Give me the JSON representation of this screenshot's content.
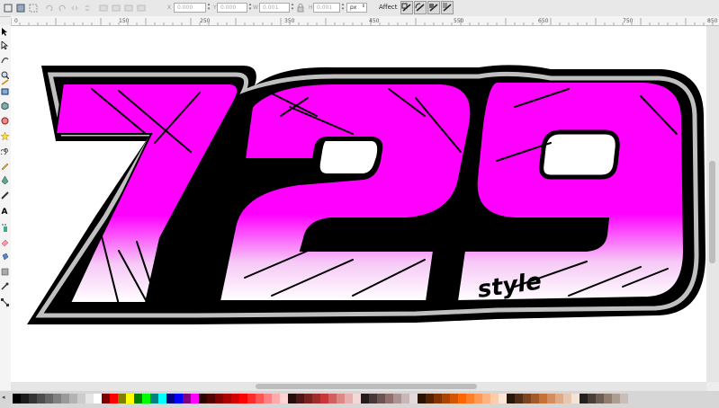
{
  "toolbar": {
    "x_label": "X",
    "x_value": "0.000",
    "y_label": "Y",
    "y_value": "0.000",
    "w_label": "W",
    "w_value": "0.001",
    "h_label": "H",
    "h_value": "0.001",
    "units": "px",
    "affect_label": "Affect",
    "left_icons": [
      "select-all-icon",
      "select-all-layers-icon",
      "deselect-icon",
      "rotate-ccw-icon",
      "rotate-cw-icon",
      "flip-horizontal-icon",
      "flip-vertical-icon",
      "raise-to-top-icon",
      "raise-icon",
      "lower-icon",
      "lower-to-bottom-icon"
    ],
    "affect_icons": [
      "scale-stroke-icon",
      "scale-corners-icon",
      "move-gradients-icon",
      "move-patterns-icon"
    ]
  },
  "ruler_top": {
    "labels": [
      "0",
      "150",
      "250",
      "350",
      "450",
      "550",
      "650",
      "750",
      "850"
    ]
  },
  "tools": [
    "selector-tool-icon",
    "node-tool-icon",
    "tweak-tool-icon",
    "zoom-tool-icon",
    "measure-tool-icon",
    "rect-tool-icon",
    "box3d-tool-icon",
    "ellipse-tool-icon",
    "star-tool-icon",
    "spiral-tool-icon",
    "pencil-tool-icon",
    "pen-tool-icon",
    "calligraphy-tool-icon",
    "text-tool-icon",
    "spray-tool-icon",
    "eraser-tool-icon",
    "paint-bucket-tool-icon",
    "gradient-tool-icon",
    "dropper-tool-icon",
    "connector-tool-icon"
  ],
  "artwork": {
    "number_text": "729",
    "sub_text": "style",
    "fill_color": "#ff00ff",
    "outline_color": "#000000",
    "stripe_color": "#c0c0c0"
  },
  "palette": {
    "colors": [
      "#000000",
      "#1a1a1a",
      "#333333",
      "#4d4d4d",
      "#666666",
      "#808080",
      "#999999",
      "#b3b3b3",
      "#cccccc",
      "#e6e6e6",
      "#ffffff",
      "#800000",
      "#ff0000",
      "#808000",
      "#ffff00",
      "#008000",
      "#00ff00",
      "#008080",
      "#00ffff",
      "#000080",
      "#0000ff",
      "#800080",
      "#ff00ff",
      "#2b0000",
      "#550000",
      "#800000",
      "#aa0000",
      "#d40000",
      "#ff0000",
      "#ff2a2a",
      "#ff5555",
      "#ff8080",
      "#ffaaaa",
      "#ffd5d5",
      "#280b0b",
      "#501616",
      "#782121",
      "#a02c2c",
      "#c83737",
      "#d35f5f",
      "#de8787",
      "#e9afaf",
      "#f4d7d7",
      "#241c1c",
      "#483737",
      "#6c5353",
      "#916f6f",
      "#ac9393",
      "#c8b7b7",
      "#e3dbdb",
      "#2b1100",
      "#552200",
      "#803300",
      "#aa4400",
      "#d45500",
      "#ff6600",
      "#ff7f2a",
      "#ff9955",
      "#ffb380",
      "#ffccaa",
      "#ffe6d5",
      "#28170b",
      "#502d16",
      "#784421",
      "#a05a2c",
      "#c87137",
      "#d38d5f",
      "#deaa87",
      "#e9c6af",
      "#f4e3d7",
      "#241f1c",
      "#483e37",
      "#6c5d53",
      "#917c6f",
      "#ac9d93",
      "#c8beb7"
    ]
  }
}
